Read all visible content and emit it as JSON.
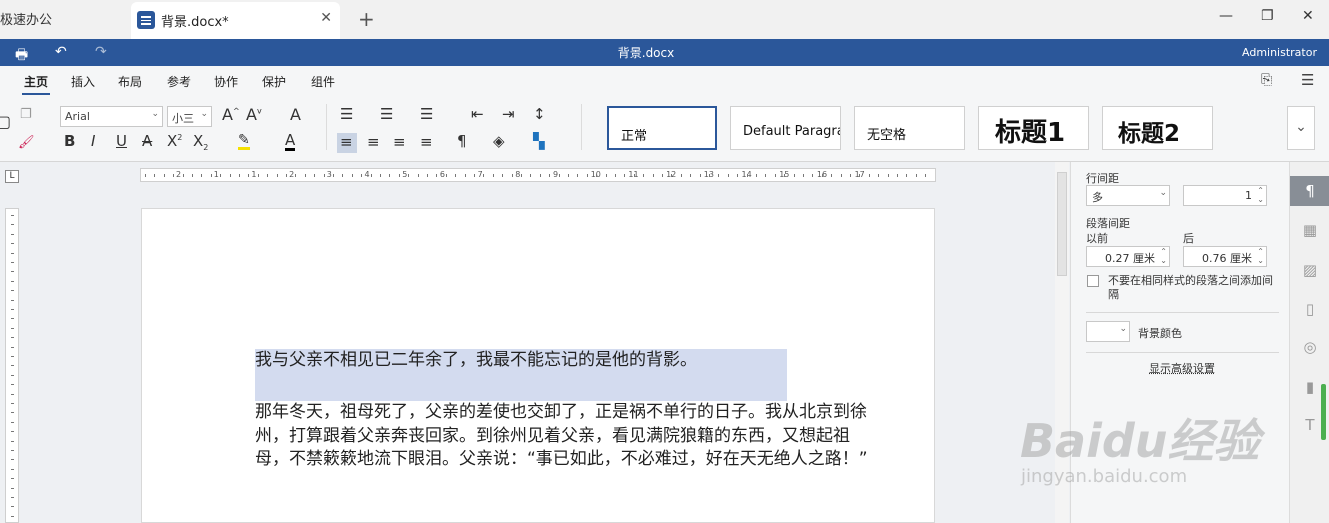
{
  "tabs": [
    {
      "label": "极速办公"
    },
    {
      "label": "背景.docx*"
    }
  ],
  "window": {
    "title": "背景.docx",
    "user": "Administrator"
  },
  "menu": [
    "主页",
    "插入",
    "布局",
    "参考",
    "协作",
    "保护",
    "组件"
  ],
  "ribbon": {
    "font_name": "Arial",
    "font_size": "小三",
    "styles": [
      "正常",
      "Default Paragraph",
      "无空格",
      "标题1",
      "标题2"
    ]
  },
  "ruler": {
    "h_numbers": [
      "2",
      "1",
      "1",
      "2",
      "3",
      "4",
      "5",
      "6",
      "7",
      "8",
      "9",
      "10",
      "11",
      "12",
      "13",
      "14",
      "15",
      "16",
      "17"
    ]
  },
  "document": {
    "paragraphs": [
      "我与父亲不相见已二年余了，我最不能忘记的是他的背影。",
      "那年冬天，祖母死了，父亲的差使也交卸了，正是祸不单行的日子。我从北京到徐州，打算跟着父亲奔丧回家。到徐州见着父亲，看见满院狼籍的东西，又想起祖母，不禁簌簌地流下眼泪。父亲说：“事已如此，不必难过，好在天无绝人之路！”"
    ]
  },
  "panel": {
    "line_spacing_label": "行间距",
    "line_spacing_type": "多",
    "line_spacing_value": "1",
    "para_spacing_label": "段落间距",
    "before_label": "以前",
    "after_label": "后",
    "before_value": "0.27 厘米",
    "after_value": "0.76 厘米",
    "no_space_same_style": "不要在相同样式的段落之间添加间隔",
    "bg_color_label": "背景颜色",
    "advanced_link": "显示高级设置"
  },
  "watermark": {
    "text": "Baidu经验",
    "url": "jingyan.baidu.com"
  },
  "colors": {
    "accent": "#2b579a",
    "selection": "#d3dbef"
  }
}
